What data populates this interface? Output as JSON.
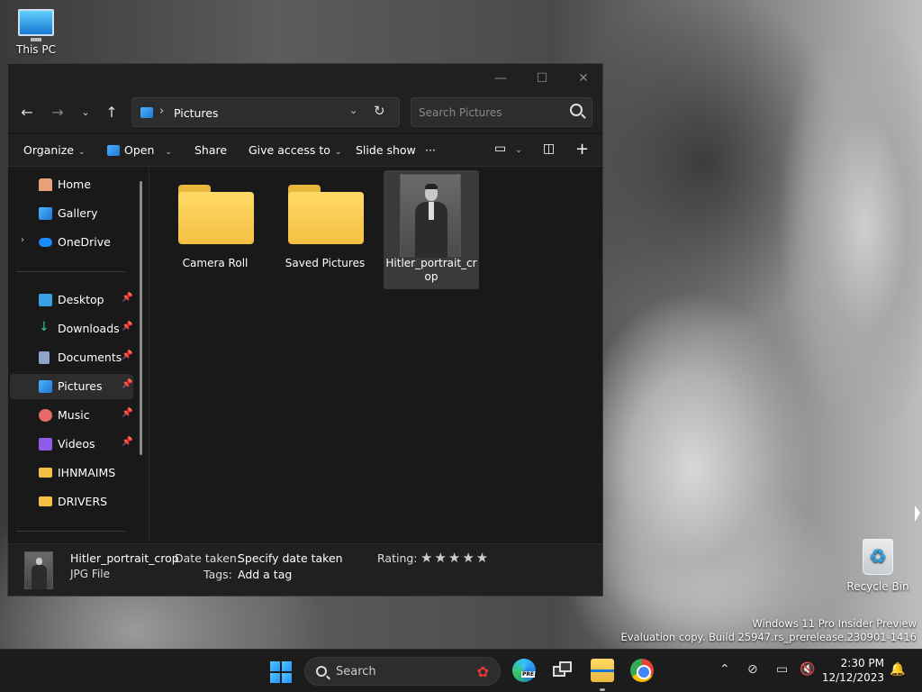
{
  "desktop": {
    "this_pc": "This PC",
    "recycle_bin": "Recycle Bin",
    "watermark_line1": "Windows 11 Pro Insider Preview",
    "watermark_line2": "Evaluation copy. Build 25947.rs_prerelease.230901-1416"
  },
  "window": {
    "minimize_glyph": "—",
    "maximize_glyph": "☐",
    "close_glyph": "✕",
    "address": {
      "separator": "›",
      "location": "Pictures"
    },
    "search": {
      "placeholder": "Search Pictures"
    },
    "commandbar": {
      "organize": "Organize",
      "open": "Open",
      "share": "Share",
      "give_access": "Give access to",
      "slideshow": "Slide show",
      "more": "···"
    },
    "sidebar": {
      "home": "Home",
      "gallery": "Gallery",
      "onedrive": "OneDrive",
      "desktop": "Desktop",
      "downloads": "Downloads",
      "documents": "Documents",
      "pictures": "Pictures",
      "music": "Music",
      "videos": "Videos",
      "ihnmaims": "IHNMAIMS",
      "drivers": "DRIVERS"
    },
    "items": [
      {
        "name": "Camera Roll",
        "kind": "folder"
      },
      {
        "name": "Saved Pictures",
        "kind": "folder"
      },
      {
        "name": "Hitler_portrait_crop",
        "kind": "image"
      }
    ],
    "details": {
      "name": "Hitler_portrait_crop",
      "type": "JPG File",
      "date_label": "Date taken:",
      "date_value": "Specify date taken",
      "tags_label": "Tags:",
      "tags_value": "Add a tag",
      "rating_label": "Rating:",
      "rating_stars": "★★★★★"
    }
  },
  "taskbar": {
    "search_label": "Search",
    "time": "2:30 PM",
    "date": "12/12/2023"
  }
}
